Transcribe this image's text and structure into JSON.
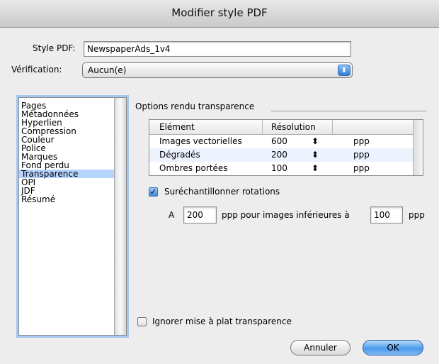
{
  "window": {
    "title": "Modifier style PDF"
  },
  "form": {
    "style_label": "Style PDF:",
    "style_value": "NewspaperAds_1v4",
    "verification_label": "Vérification:",
    "verification_value": "Aucun(e)"
  },
  "sidebar": {
    "items": [
      {
        "label": "Pages"
      },
      {
        "label": "Métadonnées"
      },
      {
        "label": "Hyperlien"
      },
      {
        "label": "Compression"
      },
      {
        "label": "Couleur"
      },
      {
        "label": "Police"
      },
      {
        "label": "Marques"
      },
      {
        "label": "Fond perdu"
      },
      {
        "label": "Transparence",
        "selected": true
      },
      {
        "label": "OPI"
      },
      {
        "label": "JDF"
      },
      {
        "label": "Résumé"
      }
    ]
  },
  "transparency": {
    "group_title": "Options rendu transparence",
    "table": {
      "headers": [
        "Elément",
        "Résolution"
      ],
      "rows": [
        {
          "element": "Images vectorielles",
          "resolution": "600",
          "unit": "ppp"
        },
        {
          "element": "Dégradés",
          "resolution": "200",
          "unit": "ppp"
        },
        {
          "element": "Ombres portées",
          "resolution": "100",
          "unit": "ppp"
        }
      ]
    },
    "oversample": {
      "label": "Suréchantillonner rotations",
      "checked": true,
      "prefix": "A",
      "value1": "200",
      "middle": "ppp pour images inférieures à",
      "value2": "100",
      "suffix": "ppp"
    },
    "ignore_flatten": {
      "label": "Ignorer mise à plat transparence",
      "checked": false
    }
  },
  "buttons": {
    "cancel": "Annuler",
    "ok": "OK"
  }
}
